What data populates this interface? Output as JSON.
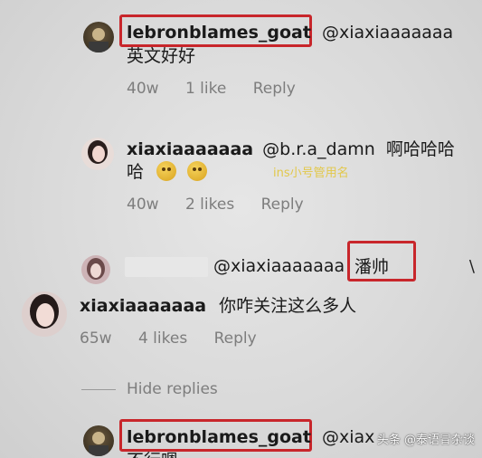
{
  "comments": [
    {
      "username": "lebronblames_goat",
      "mention": "@xiaxiaaaaaaa",
      "text": "英文好好",
      "meta": [
        "40w",
        "1 like",
        "Reply"
      ]
    },
    {
      "username": "xiaxiaaaaaaa",
      "mention": "@b.r.a_damn",
      "text_line1_suffix": "啊哈哈哈",
      "text_line2": "哈",
      "meta": [
        "40w",
        "2 likes",
        "Reply"
      ],
      "overlay": "ins小号管用名"
    },
    {
      "mention": "@xiaxiaaaaaaa",
      "text": "潘帅"
    },
    {
      "username": "xiaxiaaaaaaa",
      "text": "你咋关注这么多人",
      "meta": [
        "65w",
        "4 likes",
        "Reply"
      ]
    },
    {
      "username": "lebronblames_goat",
      "mention": "@xiax",
      "text_partial": "不行嗯"
    }
  ],
  "hide_replies": "Hide replies",
  "side_mark": "\\",
  "watermark": "头条 @泰语冒杂谈",
  "colors": {
    "highlight": "#c8262b",
    "meta": "#7d7d7d"
  }
}
